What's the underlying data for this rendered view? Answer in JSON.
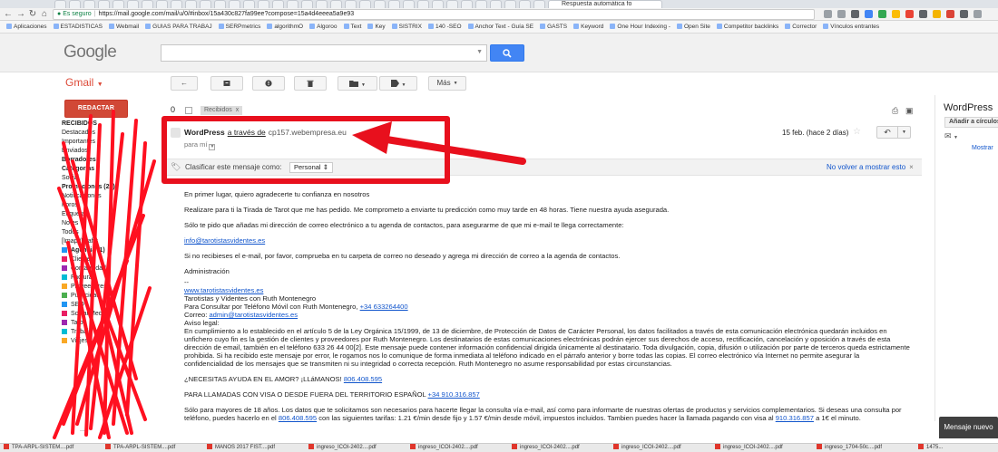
{
  "browser": {
    "active_tab_title": "Respuesta automática fo",
    "url_secure_label": "Es seguro",
    "url": "https://mail.google.com/mail/u/0/#inbox/15a430c827fa99ee?compose=15a4d4eeea5a9e93",
    "bookmarks": [
      "Aplicaciones",
      "ESTADISTICAS",
      "Webmail",
      "GUIAS PARA TRABAJ",
      "SERPmetrics",
      "algorithmO",
      "Algoroo",
      "Text",
      "Key",
      "SISTRIX",
      "140 -SEO",
      "Anchor Text - Guía SE",
      "GASTS",
      "Keyword",
      "One Hour Indexing -",
      "Open Site",
      "Competitor backlinks",
      "Corrector",
      "Vínculos entrantes"
    ],
    "extension_colors": [
      "#9aa0a6",
      "#9aa0a6",
      "#5f6368",
      "#4285f4",
      "#34a853",
      "#fbbc05",
      "#ea4335",
      "#5f6368",
      "#f4b400",
      "#db4437",
      "#5f6368",
      "#9aa0a6"
    ],
    "downloads": [
      "TPA-ARPL-SISTEM....pdf",
      "TPA-ARPL-SISTEM....pdf",
      "MANOS 2017 FIST....pdf",
      "ingreso_ICOI-2402....pdf",
      "ingreso_ICOI-2402....pdf",
      "ingreso_ICOI-2402....pdf",
      "ingreso_ICOI-2402....pdf",
      "ingreso_ICOI-2402....pdf",
      "ingreso_1704-50c....pdf",
      "1475..."
    ]
  },
  "gmail": {
    "logo": "Google",
    "search_button_icon": "search-icon",
    "label_title": "Gmail",
    "compose_label": "REDACTAR",
    "nav_items": [
      {
        "text": "RECIBIDOS",
        "bold": true
      },
      {
        "text": "Destacados",
        "bold": false
      },
      {
        "text": "Importantes",
        "bold": false
      },
      {
        "text": "Enviados",
        "bold": false
      },
      {
        "text": "Borradores",
        "bold": true
      },
      {
        "text": "Categorías",
        "bold": true
      },
      {
        "text": "Social",
        "bold": false
      },
      {
        "text": "Promociones (25)",
        "bold": true
      },
      {
        "text": "Notificaciones",
        "bold": false
      },
      {
        "text": "Foros",
        "bold": false
      },
      {
        "text": "Etiquetas",
        "bold": false
      },
      {
        "text": "Notes",
        "bold": false
      },
      {
        "text": "Todos",
        "bold": false
      },
      {
        "text": "[Imap]/Drafts",
        "bold": false
      },
      {
        "text": "Agencia (1)",
        "bold": true
      },
      {
        "text": "Clientes",
        "bold": false
      },
      {
        "text": "Contabilidad",
        "bold": false
      },
      {
        "text": "Facturas",
        "bold": false
      },
      {
        "text": "Proveedores",
        "bold": false
      },
      {
        "text": "Publicidad",
        "bold": false
      },
      {
        "text": "SEO",
        "bold": false
      },
      {
        "text": "Social Media",
        "bold": false
      },
      {
        "text": "Tarot",
        "bold": false
      },
      {
        "text": "Trabajo",
        "bold": false
      },
      {
        "text": "Viajes",
        "bold": false
      }
    ],
    "nav_more": "...",
    "toolbar": {
      "back_icon": "arrow-left-icon",
      "archive_icon": "archive-icon",
      "spam_icon": "alert-icon",
      "delete_icon": "trash-icon",
      "move_icon": "folder-icon",
      "labels_icon": "tag-icon",
      "more_label": "Más"
    }
  },
  "message": {
    "label_chip": "Recibidos",
    "label_chip_close": "x",
    "sender_name": "WordPress",
    "sender_via": "a través de",
    "sender_domain": "cp157.webempresa.eu",
    "to": "para mí",
    "date": "15 feb. (hace 2 días)",
    "classify_prompt": "Clasificar este mensaje como:",
    "classify_value": "Personal",
    "no_show_again": "No volver a mostrar esto",
    "body": {
      "p1": "En primer lugar, quiero agradecerte tu confianza en nosotros",
      "p2": "Realizare para ti la Tirada de Tarot que me has pedido. Me comprometo a enviarte tu predicción como muy tarde en 48 horas. Tiene nuestra ayuda asegurada.",
      "p3": "Sólo te pido que añadas mi dirección de correo electrónico a tu agenda de contactos, para asegurarme de que mi e-mail te llega correctamente:",
      "email_link": "info@tarotistasvidentes.es",
      "p4": "Si no recibieses el e-mail, por favor, comprueba en tu carpeta de correo no deseado y agrega mi dirección de correo a la agenda de contactos.",
      "p5": "Administración",
      "sig_dash": "--",
      "sig_site": "www.tarotistasvidentes.es",
      "sig_line1": "Tarotistas y Videntes con Ruth Montenegro",
      "sig_line2_prefix": "Para Consultar por Teléfono Móvil con Ruth Montenegro,",
      "sig_phone": "+34 633264400",
      "sig_mail_prefix": "Correo:",
      "sig_mail": "admin@tarotistasvidentes.es",
      "legal_title": "Aviso legal:",
      "legal_text": "En cumplimiento a lo establecido en el artículo 5 de la Ley Orgánica 15/1999, de 13 de diciembre, de Protección de Datos de Carácter Personal, los datos facilitados a través de esta comunicación electrónica quedarán incluidos en unfichero cuyo fin es la gestión de clientes y proveedores por Ruth Montenegro. Los destinatarios de estas comunicaciones electrónicas podrán ejercer sus derechos de acceso, rectificación, cancelación y oposición a través de esta dirección de email, también en el teléfono 633 26 44 00[2]. Este mensaje puede contener información confidencial dirigida únicamente al destinatario. Toda divulgación, copia, difusión o utilización por parte de terceros queda estrictamente prohibida. Si ha recibido este mensaje por error, le rogamos nos lo comunique de forma inmediata al teléfono indicado en el párrafo anterior y borre todas las copias. El correo electrónico vía Internet no permite asegurar la confidencialidad de los mensajes que se transmiten ni su integridad o correcta recepción. Ruth Montenegro no asume responsabilidad por estas circunstancias.",
      "help_prefix": "¿NECESITAS AYUDA EN EL AMOR? ¡LLáMANOS!",
      "help_phone": "806.408.595",
      "abroad_prefix": "PARA LLAMADAS CON VISA O DESDE FUERA DEL TERRITORIO ESPAÑOL",
      "abroad_phone": "+34 910.316.857",
      "final_a": "Sólo para mayores de 18 años. Los datos que te solicitamos son necesarios para hacerte llegar la consulta vía e-mail, así como para informarte de nuestras ofertas de productos y servicios complementarios. Si deseas una consulta por teléfono, puedes hacerlo en el",
      "final_phone1": "806.408.595",
      "final_b": "con las siguientes tarifas: 1.21 €/min desde fijo y 1.57 €/min desde móvil, impuestos incluidos. Tambien puedes hacer la llamada pagando con visa al",
      "final_phone2": "910.316.857",
      "final_c": "a 1€ el minuto."
    }
  },
  "right_panel": {
    "contact_name": "WordPress",
    "add_circles": "Añadir a círculos",
    "show_more": "Mostrar"
  },
  "new_message_label": "Mensaje nuevo",
  "annotation_color": "#e8101d"
}
